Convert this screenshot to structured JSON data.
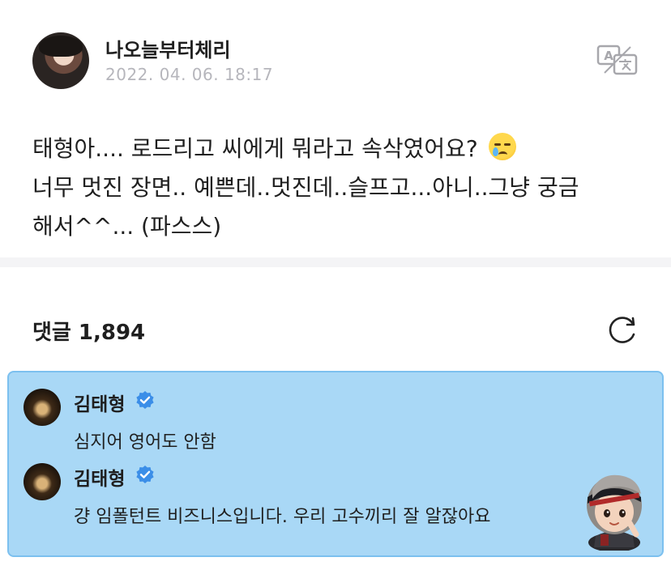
{
  "post": {
    "author": "나오늘부터체리",
    "date": "2022. 04. 06. 18:17",
    "lines": [
      "태형아.... 로드리고 씨에게 뭐라고 속삭였어요?",
      "너무 멋진 장면.. 예쁜데..멋진데..슬프고...아니..그냥 궁금",
      "해서^^... (파스스)"
    ],
    "emoji": "crying-face-emoji"
  },
  "comments": {
    "label": "댓글 1,894"
  },
  "artist_replies": [
    {
      "name": "김태형",
      "text": "심지어 영어도 안함"
    },
    {
      "name": "김태형",
      "text": "걍 임폴턴트 비즈니스입니다. 우리 고수끼리 잘 알잖아요"
    }
  ],
  "colors": {
    "artist_box_bg": "#a9d8f6",
    "artist_box_border": "#7cc0ef",
    "verified_badge": "#3b8ee8",
    "date_gray": "#b6b6bc"
  },
  "icons": {
    "translate": "translate-icon",
    "refresh": "refresh-icon",
    "verified": "verified-badge-icon",
    "sticker": "character-sticker"
  }
}
